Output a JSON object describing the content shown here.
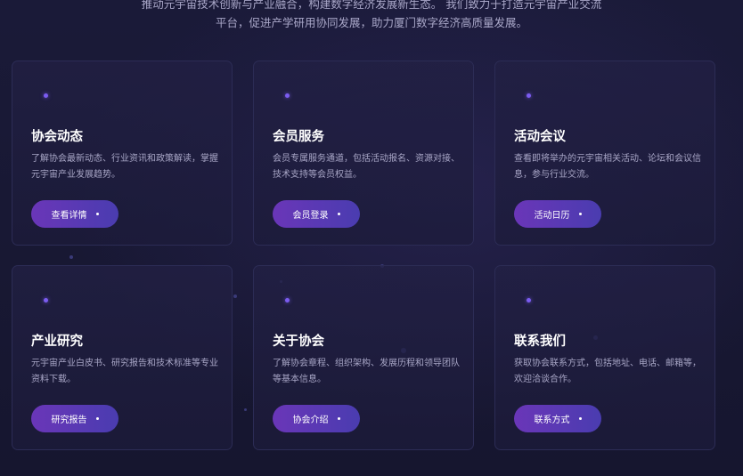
{
  "intro": {
    "line1": "推动元宇宙技术创新与产业融合，构建数字经济发展新生态。 我们致力于打造元宇宙产业交流",
    "line2": "平台，促进产学研用协同发展，助力厦门数字经济高质量发展。"
  },
  "cards": [
    {
      "title": "协会动态",
      "desc": "了解协会最新动态、行业资讯和政策解读，掌握元宇宙产业发展趋势。",
      "button": "查看详情"
    },
    {
      "title": "会员服务",
      "desc": "会员专属服务通道，包括活动报名、资源对接、技术支持等会员权益。",
      "button": "会员登录"
    },
    {
      "title": "活动会议",
      "desc": "查看即将举办的元宇宙相关活动、论坛和会议信息，参与行业交流。",
      "button": "活动日历"
    },
    {
      "title": "产业研究",
      "desc": "元宇宙产业白皮书、研究报告和技术标准等专业资料下载。",
      "button": "研究报告"
    },
    {
      "title": "关于协会",
      "desc": "了解协会章程、组织架构、发展历程和领导团队等基本信息。",
      "button": "协会介绍"
    },
    {
      "title": "联系我们",
      "desc": "获取协会联系方式，包括地址、电话、邮箱等，欢迎洽谈合作。",
      "button": "联系方式"
    }
  ],
  "colors": {
    "background": "#181833",
    "card_border": "#2c2c55",
    "accent_dot": "#7b5cf0",
    "button_gradient_start": "#6a36b8",
    "button_gradient_end": "#4a3cb0",
    "description_text": "#a8a6c6"
  },
  "icons": {
    "card_marker": "dot-icon",
    "button_marker": "dot-icon"
  }
}
